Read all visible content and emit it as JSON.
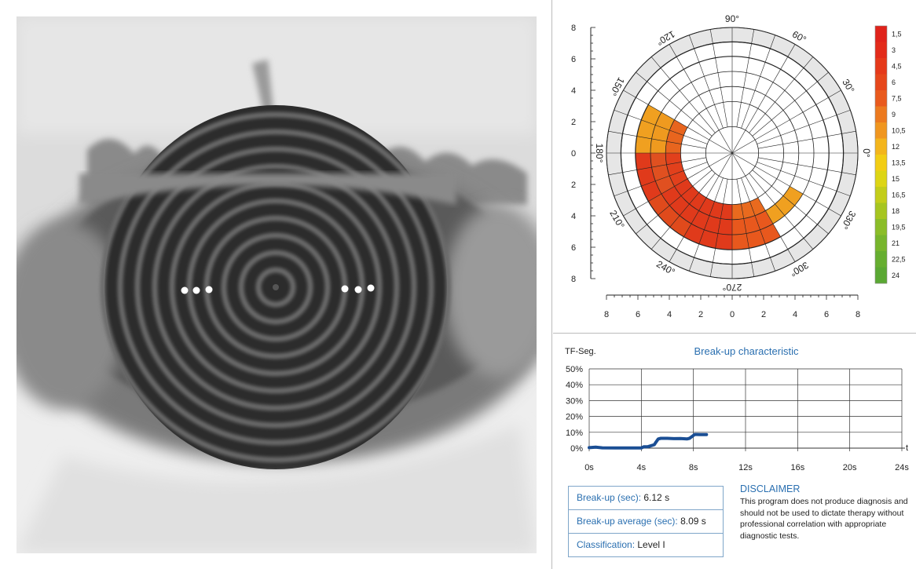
{
  "polar_plot": {
    "y_ticks": [
      "8",
      "6",
      "4",
      "2",
      "0",
      "2",
      "4",
      "6",
      "8"
    ],
    "x_ticks": [
      "8",
      "6",
      "4",
      "2",
      "0",
      "2",
      "4",
      "6",
      "8"
    ],
    "angle_labels": [
      "90°",
      "60°",
      "30°",
      "0°",
      "330°",
      "300°",
      "270°",
      "240°",
      "210°",
      "180°",
      "150°",
      "120°"
    ],
    "legend": {
      "labels": [
        "1,5",
        "3",
        "4,5",
        "6",
        "7,5",
        "9",
        "10,5",
        "12",
        "13,5",
        "15",
        "16,5",
        "18",
        "19,5",
        "21",
        "22,5",
        "24"
      ],
      "colors": [
        "#e0231b",
        "#e32b1a",
        "#e5391a",
        "#e6471b",
        "#e95a1d",
        "#ec7a1f",
        "#f0961f",
        "#f3b51c",
        "#f2cd14",
        "#ddd514",
        "#c3cd1a",
        "#a6c520",
        "#8bbd28",
        "#77b52c",
        "#66ae30",
        "#5aa833"
      ]
    },
    "highlighted_cells": [
      {
        "ring": 3,
        "sector": 6,
        "color": "#e2401c"
      },
      {
        "ring": 4,
        "sector": 6,
        "color": "#e05020"
      },
      {
        "ring": 5,
        "sector": 5,
        "color": "#f0a020"
      },
      {
        "ring": 4,
        "sector": 5,
        "color": "#ef9a1f"
      },
      {
        "ring": 3,
        "sector": 5,
        "color": "#e8651e"
      },
      {
        "ring": 3,
        "sector": 7,
        "color": "#e03a1b"
      },
      {
        "ring": 4,
        "sector": 7,
        "color": "#e03a1b"
      },
      {
        "ring": 5,
        "sector": 7,
        "color": "#e04a1c"
      },
      {
        "ring": 5,
        "sector": 6,
        "color": "#e03a1b"
      },
      {
        "ring": 3,
        "sector": 8,
        "color": "#e03a1b"
      },
      {
        "ring": 4,
        "sector": 8,
        "color": "#e03a1b"
      },
      {
        "ring": 5,
        "sector": 8,
        "color": "#e03a1b"
      },
      {
        "ring": 3,
        "sector": 9,
        "color": "#e96a1e"
      },
      {
        "ring": 4,
        "sector": 9,
        "color": "#e8581d"
      },
      {
        "ring": 5,
        "sector": 9,
        "color": "#e8581d"
      },
      {
        "ring": 4,
        "sector": 10,
        "color": "#f0a020"
      }
    ]
  },
  "breakup_chart": {
    "title": "Break-up characteristic",
    "y_axis_label": "TF-Seg.",
    "x_axis_label": "t",
    "y_ticks": [
      "50%",
      "40%",
      "30%",
      "20%",
      "10%",
      "0%"
    ],
    "x_ticks": [
      "0s",
      "4s",
      "8s",
      "12s",
      "16s",
      "20s",
      "24s"
    ]
  },
  "chart_data": {
    "type": "line",
    "title": "Break-up characteristic",
    "xlabel": "t",
    "ylabel": "TF-Seg.",
    "xlim": [
      0,
      24
    ],
    "ylim": [
      0,
      50
    ],
    "series": [
      {
        "x": [
          0,
          0.5,
          1,
          2,
          3,
          3.5,
          4,
          4.2,
          4.5,
          5,
          5.1,
          5.3,
          5.5,
          6,
          6.5,
          7,
          7.5,
          7.7,
          8,
          8.09,
          8.3,
          8.5,
          9
        ],
        "y": [
          0.3,
          0.6,
          0.2,
          0.1,
          0.1,
          0.1,
          0.1,
          0.9,
          0.9,
          2.2,
          3.5,
          5.8,
          6.2,
          6.2,
          6.0,
          6.1,
          5.8,
          6.2,
          8.0,
          8.6,
          8.6,
          8.5,
          8.5
        ]
      }
    ]
  },
  "results": {
    "breakup_key": "Break-up (sec):",
    "breakup_val": "6.12 s",
    "average_key": "Break-up average (sec):",
    "average_val": "8.09 s",
    "class_key": "Classification:",
    "class_val": "Level I"
  },
  "disclaimer": {
    "title": "DISCLAIMER",
    "text": "This program does not produce diagnosis and should not be used to dictate therapy without professional correlation with appropriate diagnostic tests."
  }
}
